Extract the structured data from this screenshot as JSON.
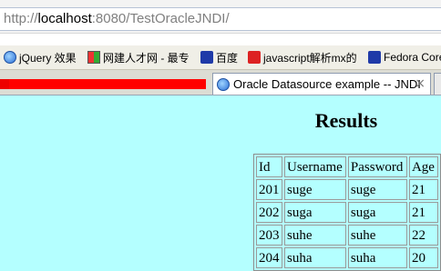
{
  "address_bar": {
    "url_protocol": "http://",
    "url_host": "localhost",
    "url_rest": ":8080/TestOracleJNDI/"
  },
  "bookmarks": [
    {
      "icon": "ie-page-icon",
      "label": "jQuery 效果"
    },
    {
      "icon": "windows-icon",
      "label": "网建人才网 - 最专"
    },
    {
      "icon": "paw-icon",
      "label": "百度"
    },
    {
      "icon": "c-icon",
      "label": "javascript解析mx的"
    },
    {
      "icon": "paw-icon",
      "label": "Fedora Core"
    }
  ],
  "tabs": [
    {
      "title": "Oracle Datasource example -- JNDI",
      "close": "×"
    }
  ],
  "page": {
    "heading": "Results",
    "table": {
      "headers": [
        "Id",
        "Username",
        "Password",
        "Age"
      ],
      "rows": [
        [
          "201",
          "suge",
          "suge",
          "21"
        ],
        [
          "202",
          "suga",
          "suga",
          "21"
        ],
        [
          "203",
          "suhe",
          "suhe",
          "22"
        ],
        [
          "204",
          "suha",
          "suha",
          "20"
        ]
      ]
    }
  },
  "colors": {
    "page_background": "#b4ffff",
    "loading_bar": "#ff0000"
  }
}
